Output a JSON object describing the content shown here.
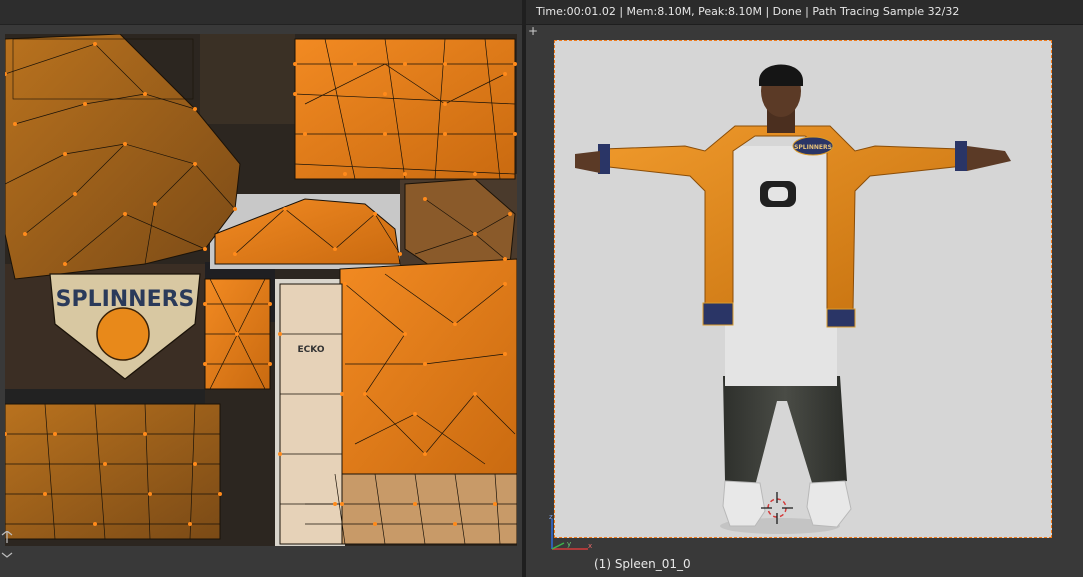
{
  "viewport": {
    "render_status": "Time:00:01.02 | Mem:8.10M, Peak:8.10M | Done | Path Tracing Sample 32/32",
    "object_name": "(1) Spleen_01_0",
    "jacket_logo_text": "SPLINNERS"
  },
  "uv_editor": {
    "texture_logo_text": "SPLINNERS",
    "tag_text": "ECKO"
  },
  "colors": {
    "jacket_orange": "#e08a1e",
    "uv_edge": "#1a1208",
    "uv_vertex": "#ff8a1a",
    "camera_border": "#f07a1a",
    "viewport_bg": "#393939",
    "render_bg": "#d6d6d6"
  },
  "icons": {
    "viewport_plus": "+",
    "cursor": "3d-cursor-icon",
    "gizmo": "axis-gizmo-icon"
  }
}
